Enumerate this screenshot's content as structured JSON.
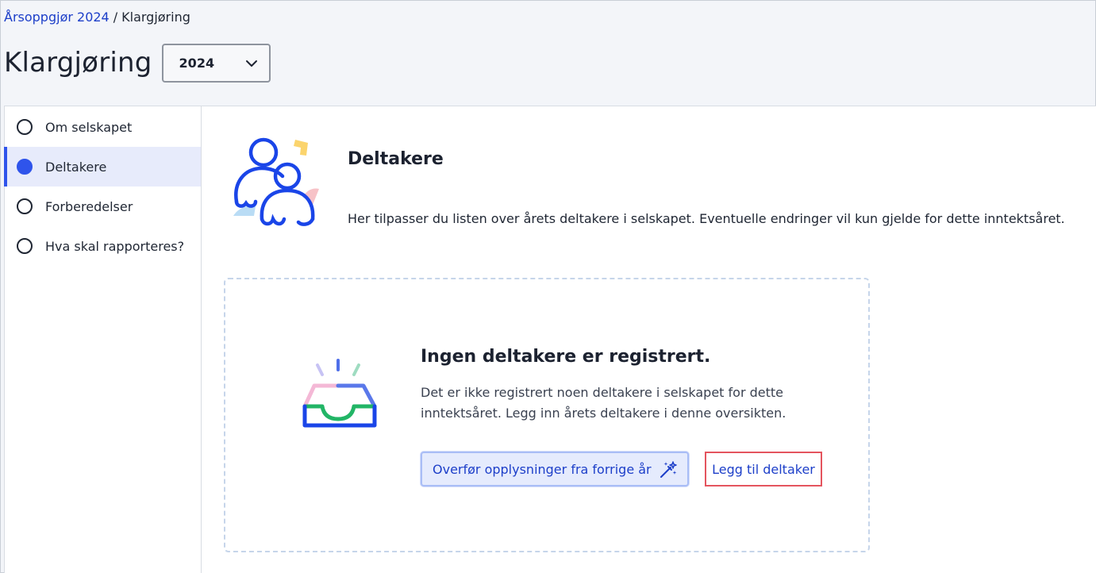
{
  "breadcrumb": {
    "parent": "Årsoppgjør 2024",
    "separator": "/",
    "current": "Klargjøring"
  },
  "header": {
    "title": "Klargjøring",
    "year_select": {
      "selected": "2024"
    }
  },
  "sidebar": {
    "items": [
      {
        "label": "Om selskapet",
        "active": false
      },
      {
        "label": "Deltakere",
        "active": true
      },
      {
        "label": "Forberedelser",
        "active": false
      },
      {
        "label": "Hva skal rapporteres?",
        "active": false
      }
    ]
  },
  "section": {
    "title": "Deltakere",
    "description": "Her tilpasser du listen over årets deltakere i selskapet. Eventuelle endringer vil kun gjelde for dette inntektsåret."
  },
  "empty_state": {
    "title": "Ingen deltakere er registrert.",
    "text": "Det er ikke registrert noen deltakere i selskapet for dette inntektsåret. Legg inn årets deltakere i denne oversikten.",
    "transfer_label": "Overfør opplysninger fra forrige år",
    "add_label": "Legg til deltaker"
  },
  "colors": {
    "accent": "#2f54eb",
    "link": "#1d3fc9",
    "highlight_border": "#e4545e"
  }
}
